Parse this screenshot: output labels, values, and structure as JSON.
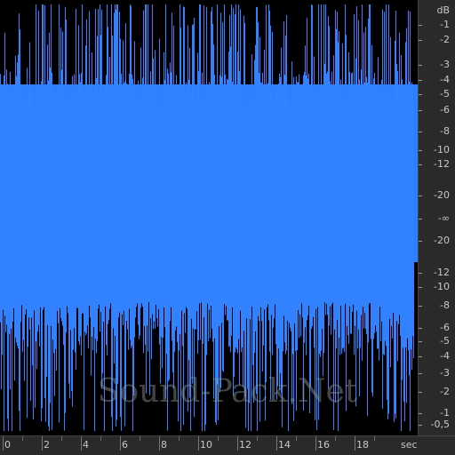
{
  "colors": {
    "waveform": "#3282ff",
    "background": "#000000",
    "ruler": "#2a2a2a"
  },
  "db_scale": {
    "unit": "dB",
    "labels": [
      "-1",
      "-2",
      "-3",
      "-4",
      "-5",
      "-6",
      "-8",
      "-10",
      "-12",
      "-20",
      "-∞",
      "-20",
      "-12",
      "-10",
      "-8",
      "-6",
      "-5",
      "-4",
      "-3",
      "-2",
      "-1",
      "-0,5"
    ]
  },
  "time_scale": {
    "unit": "sec",
    "labels": [
      "0",
      "2",
      "4",
      "6",
      "8",
      "10",
      "12",
      "14",
      "16",
      "18"
    ],
    "max_seconds": 20
  },
  "watermark": "Sound-Pack.Net"
}
